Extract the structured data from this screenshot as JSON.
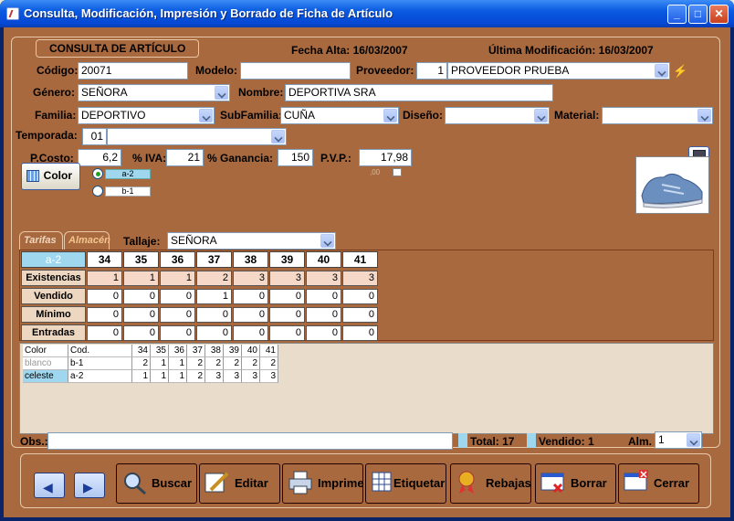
{
  "window": {
    "title": "Consulta, Modificación, Impresión y Borrado de Ficha de Artículo",
    "min": "_",
    "max": "□",
    "close": "✕"
  },
  "caption": "CONSULTA DE ARTÍCULO",
  "fecha_alta": "Fecha Alta: 16/03/2007",
  "ultima_mod": "Última Modificación: 16/03/2007",
  "labels": {
    "codigo": "Código:",
    "modelo": "Modelo:",
    "proveedor": "Proveedor:",
    "genero": "Género:",
    "nombre": "Nombre:",
    "familia": "Familia:",
    "subfamilia": "SubFamilia:",
    "diseno": "Diseño:",
    "material": "Material:",
    "temporada": "Temporada:",
    "pcosto": "P.Costo:",
    "iva": "% IVA:",
    "ganancia": "% Ganancia:",
    "pvp": "P.V.P.:",
    "tallaje": "Tallaje:",
    "obs": "Obs.:",
    "total": "Total: 17",
    "vendido": "Vendido: 1",
    "alm": "Alm."
  },
  "fields": {
    "codigo": "20071",
    "modelo": "",
    "proveedor_num": "1",
    "proveedor": "PROVEEDOR PRUEBA",
    "genero": "SEÑORA",
    "nombre": "DEPORTIVA SRA",
    "familia": "DEPORTIVO",
    "subfamilia": "CUÑA",
    "diseno": "",
    "material": "",
    "temporada_num": "01",
    "temporada": "",
    "pcosto": "6,2",
    "iva": "21",
    "ganancia": "150",
    "pvp": "17,98",
    "tallaje": "SEÑORA",
    "obs": "",
    "alm": "1",
    "pvp_sub": ",00"
  },
  "color_button": "Color",
  "radios": [
    {
      "label": "a-2",
      "on": true
    },
    {
      "label": "b-1",
      "on": false
    }
  ],
  "tabs": [
    "Tarifas",
    "Almacén"
  ],
  "grid": {
    "corner": "a-2",
    "sizes": [
      "34",
      "35",
      "36",
      "37",
      "38",
      "39",
      "40",
      "41"
    ],
    "rows": [
      {
        "label": "Existencias",
        "values": [
          "1",
          "1",
          "1",
          "2",
          "3",
          "3",
          "3",
          "3"
        ]
      },
      {
        "label": "Vendido",
        "values": [
          "0",
          "0",
          "0",
          "1",
          "0",
          "0",
          "0",
          "0"
        ]
      },
      {
        "label": "Mínimo",
        "values": [
          "0",
          "0",
          "0",
          "0",
          "0",
          "0",
          "0",
          "0"
        ]
      },
      {
        "label": "Entradas",
        "values": [
          "0",
          "0",
          "0",
          "0",
          "0",
          "0",
          "0",
          "0"
        ]
      }
    ]
  },
  "mini": {
    "headers": [
      "Color",
      "Cod.",
      "34",
      "35",
      "36",
      "37",
      "38",
      "39",
      "40",
      "41"
    ],
    "rows": [
      [
        "blanco",
        "b-1",
        "2",
        "1",
        "1",
        "2",
        "2",
        "2",
        "2",
        "2"
      ],
      [
        "celeste",
        "a-2",
        "1",
        "1",
        "1",
        "2",
        "3",
        "3",
        "3",
        "3"
      ]
    ]
  },
  "buttons": [
    "Buscar",
    "Editar",
    "Imprime",
    "Etiquetar",
    "Rebajas",
    "Borrar",
    "Cerrar"
  ],
  "colors": {
    "accent": "#0a5ae0",
    "panel": "#a9693f",
    "highlight": "#9fd7ef",
    "row_label": "#eed7c0"
  }
}
